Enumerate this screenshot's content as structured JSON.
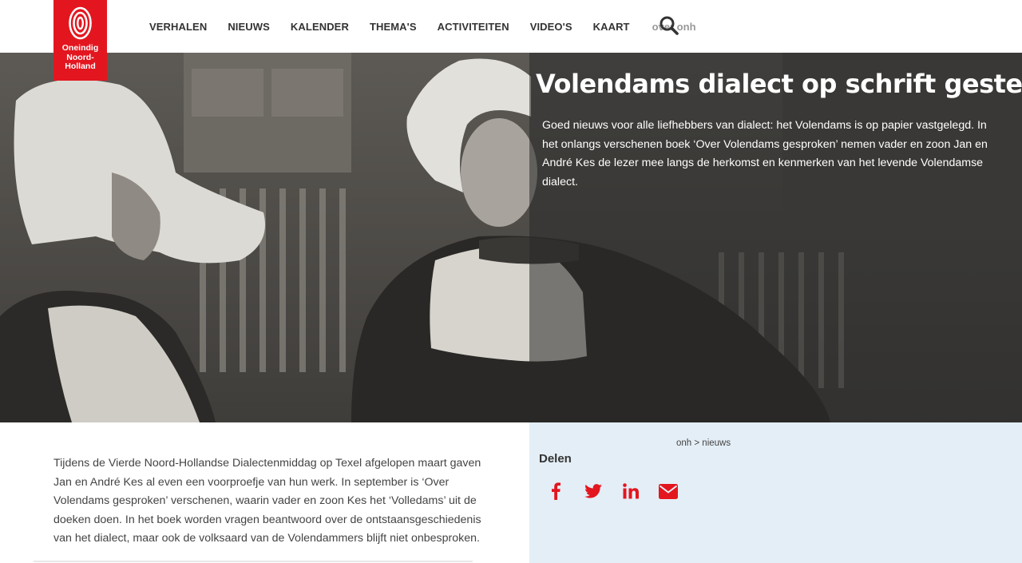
{
  "brand": {
    "logo_text_1": "Oneindig",
    "logo_text_2": "Noord-",
    "logo_text_3": "Holland",
    "color": "#e3161f"
  },
  "nav": {
    "items": [
      "VERHALEN",
      "NIEUWS",
      "KALENDER",
      "THEMA'S",
      "ACTIVITEITEN",
      "VIDEO'S",
      "KAART"
    ],
    "search_label": "over onh",
    "search_icon": "search-icon"
  },
  "hero": {
    "title": "Volendams dialect op schrift gesteld",
    "intro": "Goed nieuws voor alle liefhebbers van dialect: het Volendams is op papier vastgelegd. In het onlangs verschenen boek ‘Over Volendams gesproken’ nemen vader en zoon Jan en André Kes de lezer mee langs de herkomst en kenmerken van het levende Volendamse dialect."
  },
  "article": {
    "body": "Tijdens de Vierde Noord-Hollandse Dialectenmiddag op Texel afgelopen maart gaven Jan en André Kes al even een voorproefje van hun werk. In september is ‘Over Volendams gesproken’ verschenen, waarin vader en zoon Kes het ‘Volledams’ uit de doeken doen. In het boek worden vragen beantwoord over de ontstaansgeschiedenis van het dialect, maar ook de volksaard van de Volendammers blijft niet onbesproken."
  },
  "sidebar": {
    "breadcrumb": "onh > nieuws",
    "share_title": "Delen",
    "share_icons": [
      "facebook-icon",
      "twitter-icon",
      "linkedin-icon",
      "email-icon"
    ],
    "share_color": "#e3161f",
    "background": "#e4eef6"
  }
}
